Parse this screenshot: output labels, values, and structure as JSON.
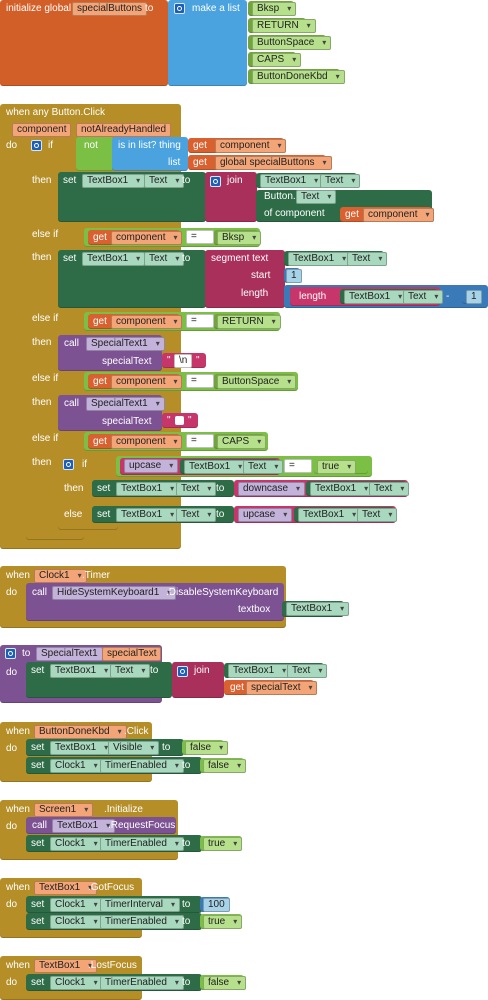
{
  "s1": {
    "prefix": "initialize global",
    "var_name": "specialButtons",
    "to": "to",
    "make_list": "make a list",
    "items": [
      "Bksp",
      "RETURN",
      "ButtonSpace",
      "CAPS",
      "ButtonDoneKbd"
    ]
  },
  "s2": {
    "header": "when any Button.Click",
    "param1": "component",
    "param2": "notAlreadyHandled",
    "do": "do",
    "if": "if",
    "then": "then",
    "else_if": "else if",
    "else": "else",
    "not": "not",
    "is_in_list": "is in list? thing",
    "list": "list",
    "get": "get",
    "component": "component",
    "global_var": "global specialButtons",
    "set": "set",
    "to": "to",
    "textbox": "TextBox1",
    "text_prop": "Text",
    "join": "join",
    "button": "Button.",
    "of_component": "of component",
    "eq": "=",
    "bksp": "Bksp",
    "segment_text": "segment  text",
    "start": "start",
    "length_lbl": "length",
    "length_fn": "length",
    "one": "1",
    "minus": "-",
    "call": "call",
    "special_text1": "SpecialText1",
    "special_text": "specialText",
    "newline": "\\n",
    "return_val": "RETURN",
    "button_space": "ButtonSpace",
    "caps": "CAPS",
    "upcase": "upcase",
    "downcase": "downcase",
    "true_val": "true",
    "quote": "\"",
    "space_glyph": "_"
  },
  "s3": {
    "when": "when",
    "component": "Clock1",
    "event": ".Timer",
    "do": "do",
    "call": "call",
    "target": "HideSystemKeyboard1",
    "method": ".DisableSystemKeyboard",
    "arg_label": "textbox",
    "arg_value": "TextBox1"
  },
  "s4": {
    "to": "to",
    "proc_name": "SpecialText1",
    "param": "specialText",
    "do": "do",
    "set": "set",
    "textbox": "TextBox1",
    "text_prop": "Text",
    "to2": "to",
    "join": "join",
    "get": "get",
    "get_var": "specialText"
  },
  "s5": {
    "when": "when",
    "component": "ButtonDoneKbd",
    "event": ".Click",
    "do": "do",
    "set": "set",
    "to": "to",
    "c1": "TextBox1",
    "p1": "Visible",
    "v1": "false",
    "c2": "Clock1",
    "p2": "TimerEnabled",
    "v2": "false"
  },
  "s6": {
    "when": "when",
    "component": "Screen1",
    "event": ".Initialize",
    "do": "do",
    "call": "call",
    "target": "TextBox1",
    "method": ".RequestFocus",
    "set": "set",
    "to": "to",
    "c2": "Clock1",
    "p2": "TimerEnabled",
    "v2": "true"
  },
  "s7": {
    "when": "when",
    "component": "TextBox1",
    "event": ".GotFocus",
    "do": "do",
    "set": "set",
    "to": "to",
    "c1": "Clock1",
    "p1": "TimerInterval",
    "v1": "100",
    "c2": "Clock1",
    "p2": "TimerEnabled",
    "v2": "true"
  },
  "s8": {
    "when": "when",
    "component": "TextBox1",
    "event": ".LostFocus",
    "do": "do",
    "set": "set",
    "to": "to",
    "c1": "Clock1",
    "p1": "TimerEnabled",
    "v1": "false"
  }
}
